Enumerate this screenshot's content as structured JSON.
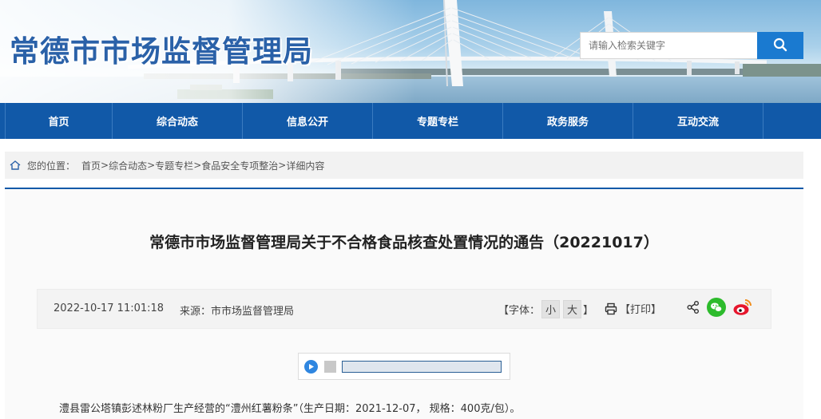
{
  "header": {
    "site_title": "常德市市场监督管理局",
    "search_placeholder": "请输入检索关键字"
  },
  "nav": {
    "items": [
      "首页",
      "综合动态",
      "信息公开",
      "专题专栏",
      "政务服务",
      "互动交流"
    ]
  },
  "breadcrumb": {
    "prefix": "您的位置：",
    "links": [
      "首页",
      "综合动态",
      "专题专栏",
      "食品安全专项整治"
    ],
    "current": "详细内容",
    "sep": " >"
  },
  "article": {
    "title": "常德市市场监督管理局关于不合格食品核查处置情况的通告（20221017）",
    "date": "2022-10-17 11:01:18",
    "source": "来源：市市场监督管理局",
    "font_prefix": "【字体：",
    "font_small": "小",
    "font_large": "大",
    "font_suffix": "】",
    "print_label": "【打印】",
    "body_first_line": "澧县雷公塔镇彭述林粉厂生产经营的“澧州红薯粉条”（生产日期：2021-12-07， 规格：400克/包）。"
  },
  "colors": {
    "brand_blue": "#1159a8",
    "title_blue": "#2a61a8",
    "search_button": "#1a7ad0",
    "wechat_green": "#2dbb2c",
    "weibo_red": "#e6162d"
  },
  "icons": [
    "search-icon",
    "home-icon",
    "printer-icon",
    "share-icon",
    "wechat-icon",
    "weibo-icon",
    "play-icon"
  ]
}
